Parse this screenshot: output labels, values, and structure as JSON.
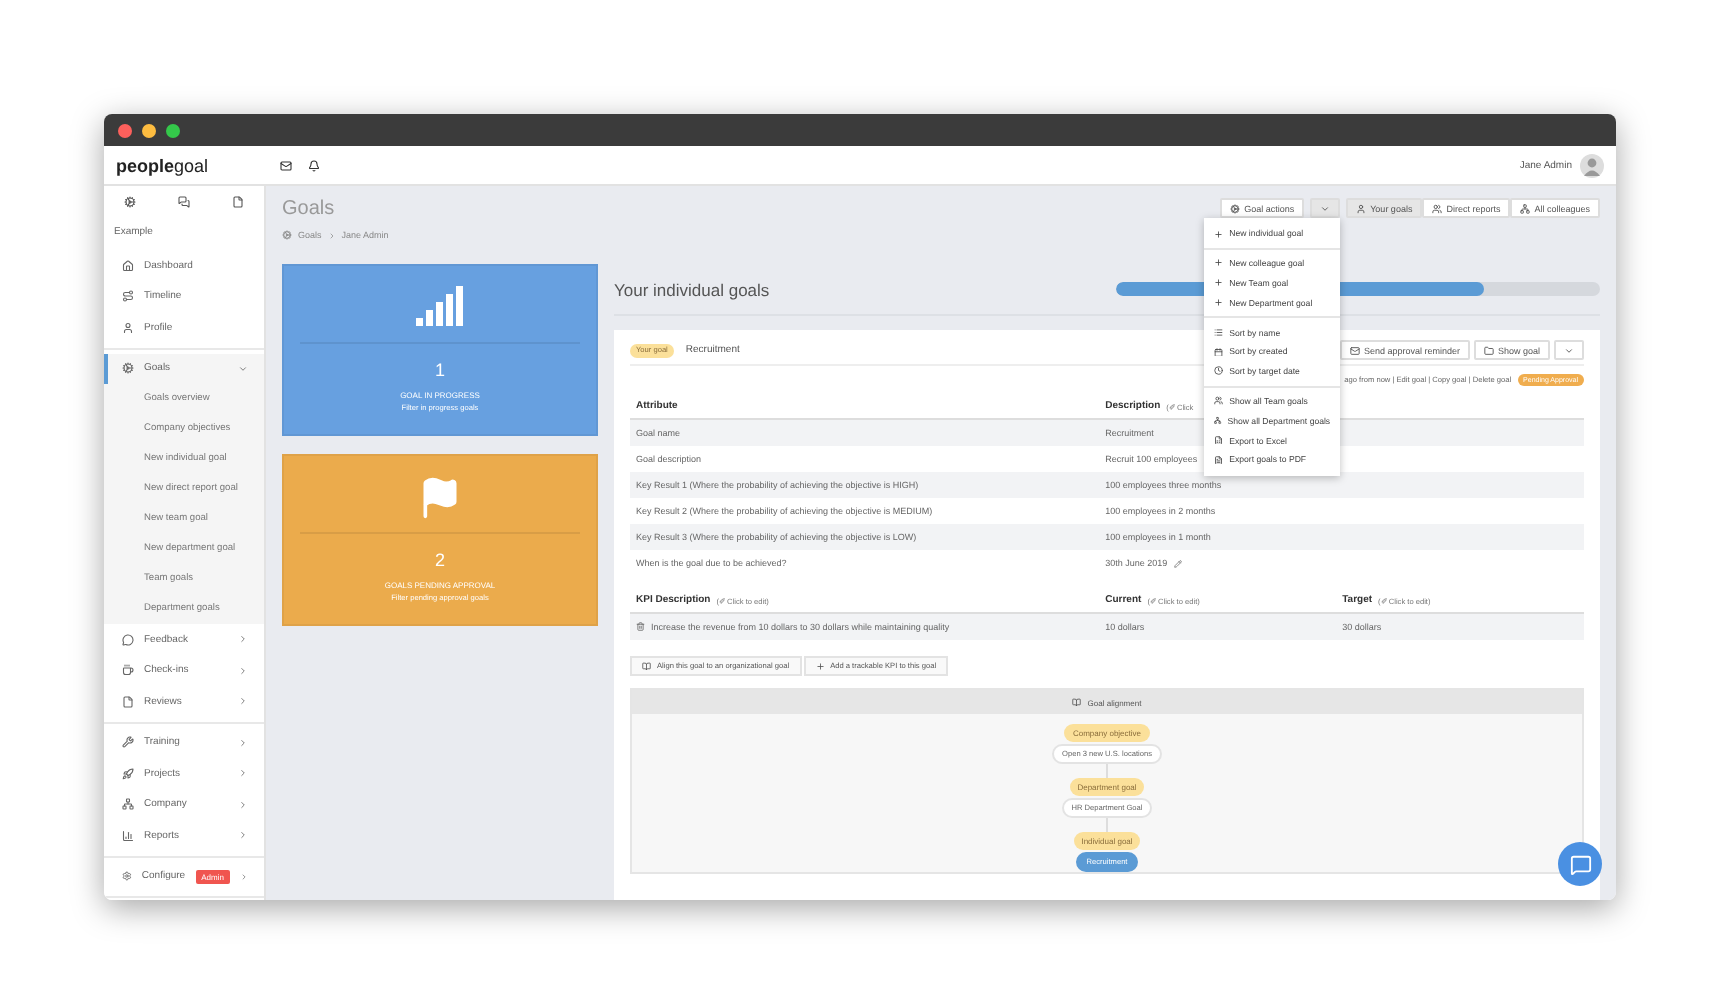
{
  "header": {
    "logo_bold": "people",
    "logo_light": "goal",
    "user": "Jane Admin"
  },
  "sidebar": {
    "section_label": "Example",
    "groups": [
      [
        {
          "label": "Dashboard",
          "selected": false
        },
        {
          "label": "Timeline",
          "selected": false
        },
        {
          "label": "Profile",
          "selected": false
        }
      ],
      [
        {
          "label": "Goals",
          "selected": true,
          "expanded": true,
          "children": [
            {
              "label": "Goals overview"
            },
            {
              "label": "Company objectives"
            },
            {
              "label": "New individual goal"
            },
            {
              "label": "New direct report goal"
            },
            {
              "label": "New team goal"
            },
            {
              "label": "New department goal"
            },
            {
              "label": "Team goals"
            },
            {
              "label": "Department goals"
            }
          ]
        },
        {
          "label": "Feedback",
          "selected": false,
          "expanded": false
        },
        {
          "label": "Check-ins",
          "selected": false,
          "expanded": false
        },
        {
          "label": "Reviews",
          "selected": false,
          "expanded": false
        }
      ],
      [
        {
          "label": "Training",
          "selected": false,
          "expanded": false
        },
        {
          "label": "Projects",
          "selected": false,
          "expanded": false
        },
        {
          "label": "Company",
          "selected": false,
          "expanded": false
        },
        {
          "label": "Reports",
          "selected": false,
          "expanded": false
        }
      ],
      [
        {
          "label": "Configure",
          "selected": false,
          "expanded": false,
          "badge": "Admin"
        }
      ]
    ]
  },
  "page": {
    "title": "Goals",
    "breadcrumb": [
      "Goals",
      "Jane Admin"
    ]
  },
  "actions": {
    "label": "Goal actions",
    "menu_open": true,
    "menu": [
      [
        "New individual goal"
      ],
      [
        "New colleague goal",
        "New Team goal",
        "New Department goal"
      ],
      [
        "Sort by name",
        "Sort by created",
        "Sort by target date"
      ],
      [
        "Show all Team goals",
        "Show all Department goals",
        "Export to Excel",
        "Export goals to PDF"
      ]
    ]
  },
  "views": [
    {
      "label": "Your goals",
      "selected": true
    },
    {
      "label": "Direct reports",
      "selected": false
    },
    {
      "label": "All colleagues",
      "selected": false
    }
  ],
  "stats": [
    {
      "value": "1",
      "label": "GOAL IN PROGRESS",
      "link": "Filter in progress goals",
      "color": "#67a0e0"
    },
    {
      "value": "2",
      "label": "GOALS PENDING APPROVAL",
      "link": "Filter pending approval goals",
      "color": "#ebab4c"
    }
  ],
  "goals": {
    "title": "Your individual goals",
    "level": 0.76
  },
  "goal": {
    "tag": "Your goal",
    "title": "Recruitment",
    "buttons": [
      "Send approval reminder",
      "Show goal"
    ],
    "meta": "ago from now | Edit goal | Copy goal | Delete goal",
    "status": "Pending Approval",
    "attributes": {
      "columns": [
        {
          "label": "Attribute"
        },
        {
          "label": "Description",
          "hint": "(✐ Click"
        }
      ],
      "rows": [
        [
          "Goal name",
          "Recruitment"
        ],
        [
          "Goal description",
          "Recruit 100 employees"
        ],
        [
          "Key Result 1 (Where the probability of achieving the objective is HIGH)",
          "100 employees three months"
        ],
        [
          "Key Result 2 (Where the probability of achieving the objective is MEDIUM)",
          "100 employees in 2 months"
        ],
        [
          "Key Result 3 (Where the probability of achieving the objective is LOW)",
          "100 employees in 1 month"
        ],
        [
          "When is the goal due to be achieved?",
          "30th June 2019"
        ]
      ]
    },
    "kpis": {
      "columns": [
        {
          "label": "KPI Description",
          "hint": "(✐ Click to edit)"
        },
        {
          "label": "Current",
          "hint": "(✐ Click to edit)"
        },
        {
          "label": "Target",
          "hint": "(✐ Click to edit)"
        }
      ],
      "rows": [
        [
          "Increase the revenue from 10 dollars to 30 dollars while maintaining quality",
          "10 dollars",
          "30 dollars"
        ]
      ]
    },
    "links": [
      "Align this goal to an organizational goal",
      "Add a trackable KPI to this goal"
    ],
    "alignment": {
      "title": "Goal alignment",
      "nodes": [
        {
          "level": "Company objective",
          "name": "Open 3 new U.S. locations",
          "selected": false
        },
        {
          "level": "Department goal",
          "name": "HR Department Goal",
          "selected": false
        },
        {
          "level": "Individual goal",
          "name": "Recruitment",
          "selected": true
        }
      ]
    }
  }
}
